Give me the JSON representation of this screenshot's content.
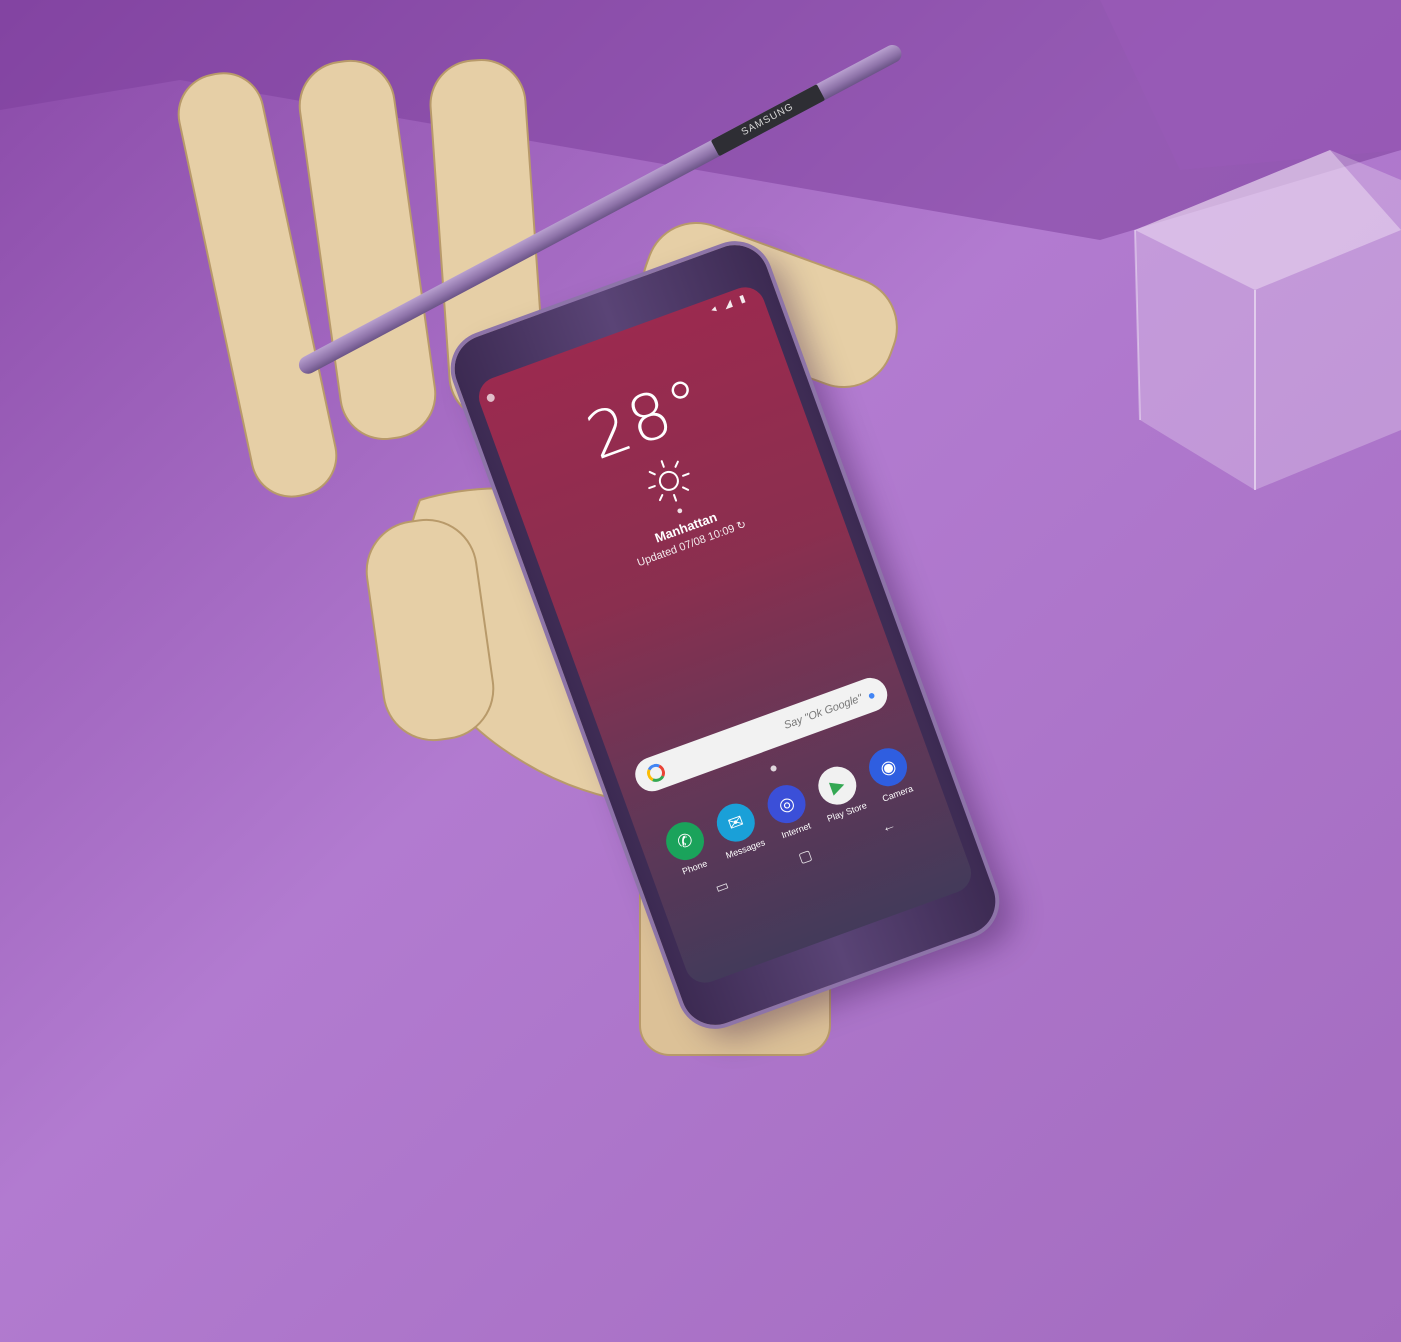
{
  "phone": {
    "weather": {
      "temperature": "28",
      "degree": "°",
      "location": "Manhattan",
      "updated": "Updated 07/08 10:09",
      "icon": "sun-icon"
    },
    "search": {
      "placeholder": "Say \"Ok Google\"",
      "icon": "google-icon",
      "mic_icon": "mic-icon"
    },
    "apps": [
      {
        "label": "Phone",
        "icon": "phone-icon",
        "color": "#1aa35b"
      },
      {
        "label": "Messages",
        "icon": "messages-icon",
        "color": "#1aa0d8"
      },
      {
        "label": "Internet",
        "icon": "internet-icon",
        "color": "#3b4fd8"
      },
      {
        "label": "Play Store",
        "icon": "play-store-icon",
        "color": "#f1f1f1"
      },
      {
        "label": "Camera",
        "icon": "camera-icon",
        "color": "#2f5ee0"
      }
    ]
  },
  "stylus": {
    "brand": "SAMSUNG"
  },
  "colors": {
    "background": "#a86ec4",
    "wood": "#e6cfa6",
    "screen_top": "#9b2a4f",
    "screen_bottom": "#433a5a"
  }
}
